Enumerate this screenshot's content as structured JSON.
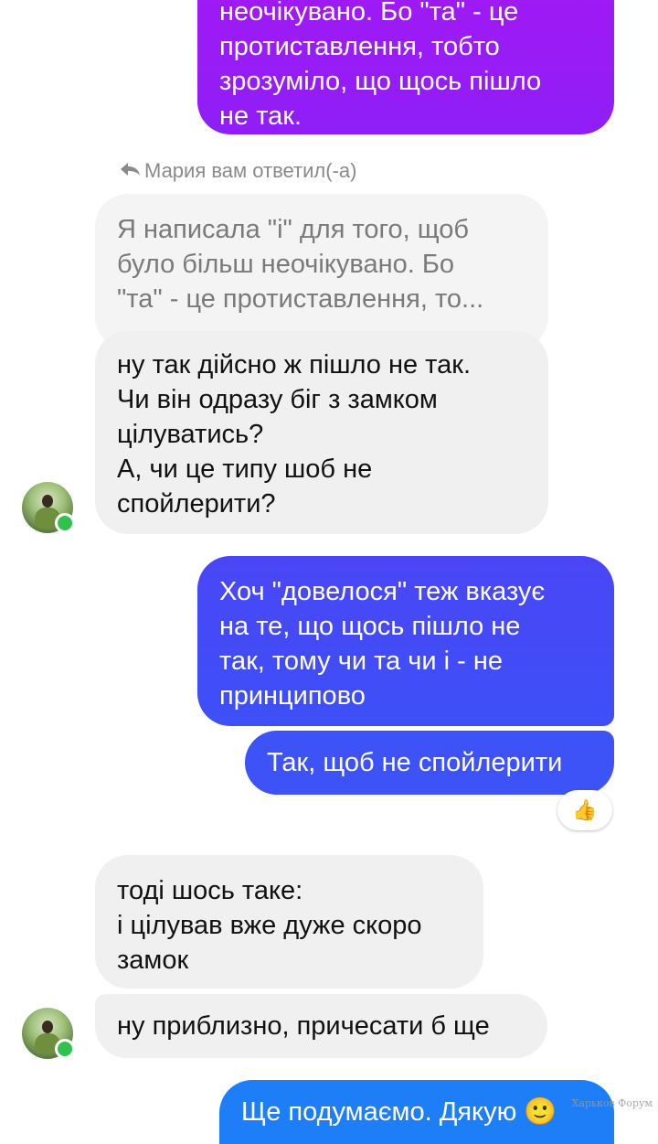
{
  "messages": {
    "m1_outgoing": "неочікувано. Бо \"та\" - це\nпротиставлення, тобто\nзрозуміло, що щось пішло\nне так.",
    "reply_note": "Мария вам ответил(-а)",
    "quoted_text": "Я написала \"і\" для того, щоб\nбуло більш неочікувано. Бо\n\"та\" - це протиставлення, то...",
    "m2_incoming": "ну так дійсно ж пішло не так.\nЧи він одразу біг з замком\nцілуватись?\nА, чи це типу шоб не\nспойлерити?",
    "m3_outgoing": "Хоч \"довелося\" теж вказує\nна те, що щось пішло не\nтак, тому чи та чи і - не\nпринципово",
    "m4_outgoing": "Так, щоб не спойлерити",
    "reaction_emoji": "👍",
    "m5_incoming": "тоді шось таке:\nі цілував вже дуже скоро\nзамок",
    "m6_incoming": "ну приблизно, причесати б ще",
    "m7_outgoing": "Ще подумаємо. Дякую 🙂"
  },
  "watermark": "Харьков Форум",
  "colors": {
    "outgoing_gradient_top": "#a319f5",
    "outgoing_gradient_bottom": "#3b53f7",
    "incoming_bg": "#f0f0f0",
    "online": "#31c24d"
  }
}
